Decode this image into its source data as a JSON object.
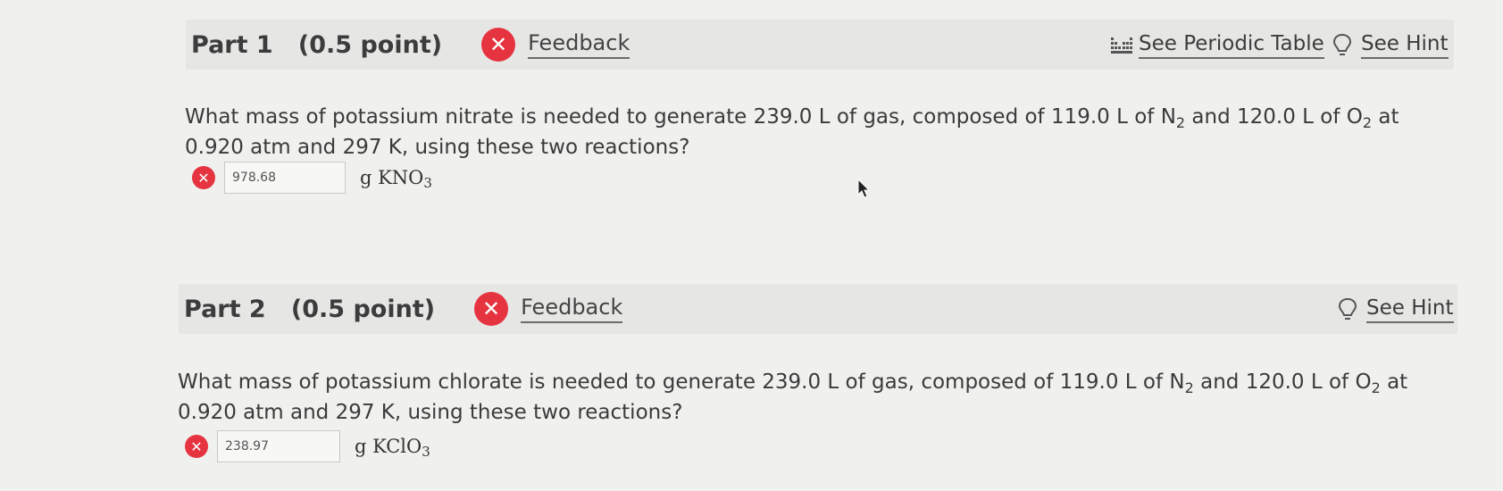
{
  "part1": {
    "title": "Part 1   (0.5 point)",
    "feedback_label": "Feedback",
    "periodic_label": "See Periodic Table",
    "hint_label": "See Hint",
    "question": {
      "pre": "What mass of potassium nitrate is needed to generate 239.0  L of gas, composed of 119.0  L of N",
      "sub1": "2",
      "mid": " and 120.0  L of O",
      "sub2": "2",
      "post": " at 0.920 atm and 297  K, using these two reactions?"
    },
    "answer_value": "978.68",
    "unit": {
      "pre": "g KNO",
      "sub": "3"
    }
  },
  "part2": {
    "title": "Part 2   (0.5 point)",
    "feedback_label": "Feedback",
    "hint_label": "See Hint",
    "question": {
      "pre": "What mass of potassium chlorate is needed to generate 239.0 L of gas, composed of 119.0 L of N",
      "sub1": "2",
      "mid": " and 120.0 L of O",
      "sub2": "2",
      "post": " at 0.920 atm and 297 K, using these two reactions?"
    },
    "answer_value": "238.97",
    "unit": {
      "pre": "g KClO",
      "sub": "3"
    }
  },
  "icons": {
    "feedback": "close-circle-icon",
    "periodic": "periodic-table-icon",
    "hint": "lightbulb-icon",
    "cursor": "mouse-pointer-icon"
  },
  "colors": {
    "error_red": "#e5333f",
    "header_bg": "#e6e6e4",
    "page_bg": "#f0f0ee"
  }
}
